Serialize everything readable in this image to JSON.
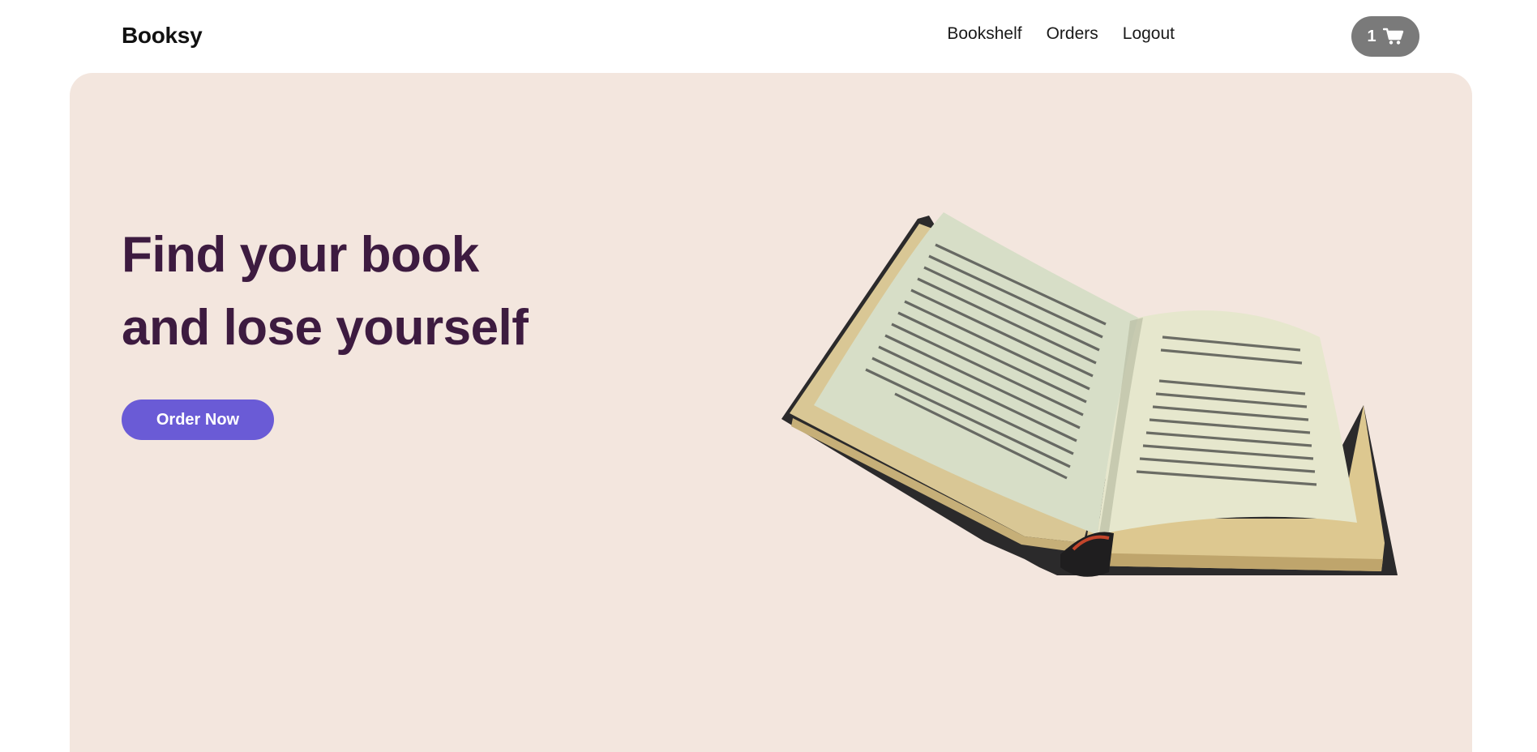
{
  "header": {
    "brand": "Booksy",
    "nav": [
      {
        "label": "Bookshelf"
      },
      {
        "label": "Orders"
      },
      {
        "label": "Logout"
      }
    ],
    "cart": {
      "count": "1",
      "icon": "cart-icon"
    }
  },
  "hero": {
    "title_line1": "Find your book",
    "title_line2": "and lose yourself",
    "cta_label": "Order Now",
    "image": "open-book-image"
  },
  "colors": {
    "hero_background": "#f3e6de",
    "title": "#3d1b40",
    "cta": "#6a5bd6",
    "cart_button": "#7a7a7a"
  }
}
